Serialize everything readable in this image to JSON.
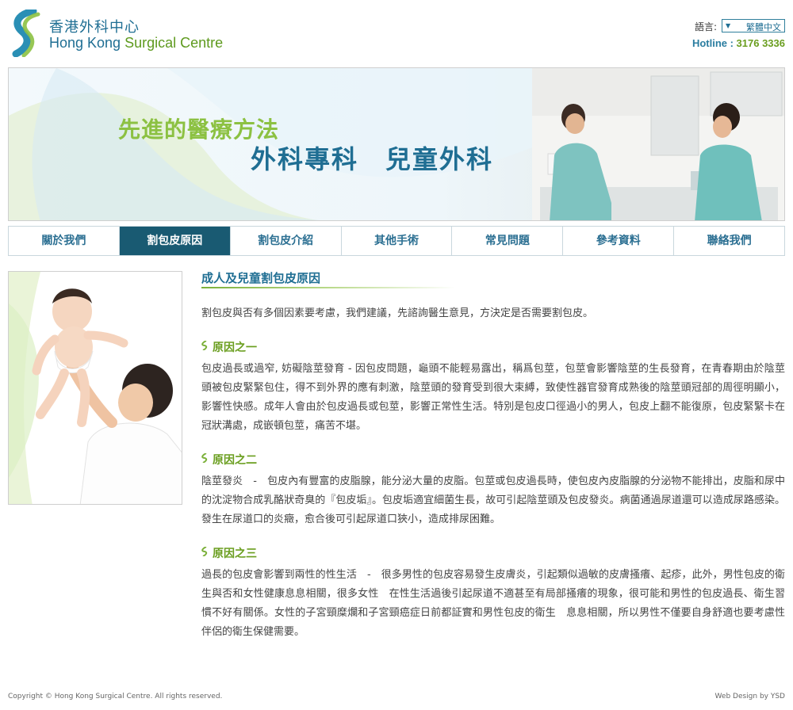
{
  "header": {
    "logo_zh": "香港外科中心",
    "logo_en_hk": "Hong Kong",
    "logo_en_rest": " Surgical Centre",
    "lang_label": "語言:",
    "lang_value": "繁體中文",
    "hotline_label": "Hotline : ",
    "hotline_number": "3176 3336"
  },
  "banner": {
    "tagline1": "先進的醫療方法",
    "tagline2": "外科專科　兒童外科"
  },
  "nav": {
    "items": [
      "關於我們",
      "割包皮原因",
      "割包皮介紹",
      "其他手術",
      "常見問題",
      "參考資料",
      "聯絡我們"
    ],
    "active_index": 1
  },
  "content": {
    "title": "成人及兒童割包皮原因",
    "intro": "割包皮與否有多個因素要考慮，我們建議，先諮詢醫生意見，方決定是否需要割包皮。",
    "sections": [
      {
        "heading": "原因之一",
        "body": "包皮過長或過窄, 妨礙陰莖發育 - 因包皮問題，龜頭不能輕易露出，稱爲包莖，包莖會影響陰莖的生長發育，在青春期由於陰莖頭被包皮緊緊包住，得不到外界的應有刺激，陰莖頭的發育受到很大束縛，致使性器官發育成熟後的陰莖頭冠部的周徑明顯小，影響性快感。成年人會由於包皮過長或包莖，影響正常性生活。特別是包皮口徑過小的男人，包皮上翻不能復原，包皮緊緊卡在冠狀溝處，成嵌頓包莖，痛苦不堪。"
      },
      {
        "heading": "原因之二",
        "body": "陰莖發炎　-　包皮內有豐富的皮脂腺，能分泌大量的皮脂。包莖或包皮過長時，使包皮內皮脂腺的分泌物不能排出，皮脂和尿中的沈淀物合成乳酪狀奇臭的『包皮垢』。包皮垢適宜細菌生長，故可引起陰莖頭及包皮發炎。病菌通過尿道還可以造成尿路感染。發生在尿道口的炎癥，愈合後可引起尿道口狹小，造成排尿困難。"
      },
      {
        "heading": "原因之三",
        "body": "過長的包皮會影響到兩性的性生活　-　很多男性的包皮容易發生皮膚炎，引起類似過敏的皮膚搔癢、起疹，此外，男性包皮的衛生與否和女性健康息息相關，很多女性　在性生活過後引起尿道不適甚至有局部搔癢的現象，很可能和男性的包皮過長、衛生習慣不好有關係。女性的子宮頸糜爛和子宮頸癌症日前都証實和男性包皮的衛生　息息相關，所以男性不僅要自身舒適也要考慮性伴侶的衛生保健需要。"
      }
    ]
  },
  "footer": {
    "copyright": "Copyright © Hong Kong Surgical Centre. All rights reserved.",
    "credit": "Web Design by YSD"
  },
  "colors": {
    "brand_blue": "#1f6e93",
    "brand_green": "#6a9e1f",
    "nav_active_bg": "#195a72"
  }
}
